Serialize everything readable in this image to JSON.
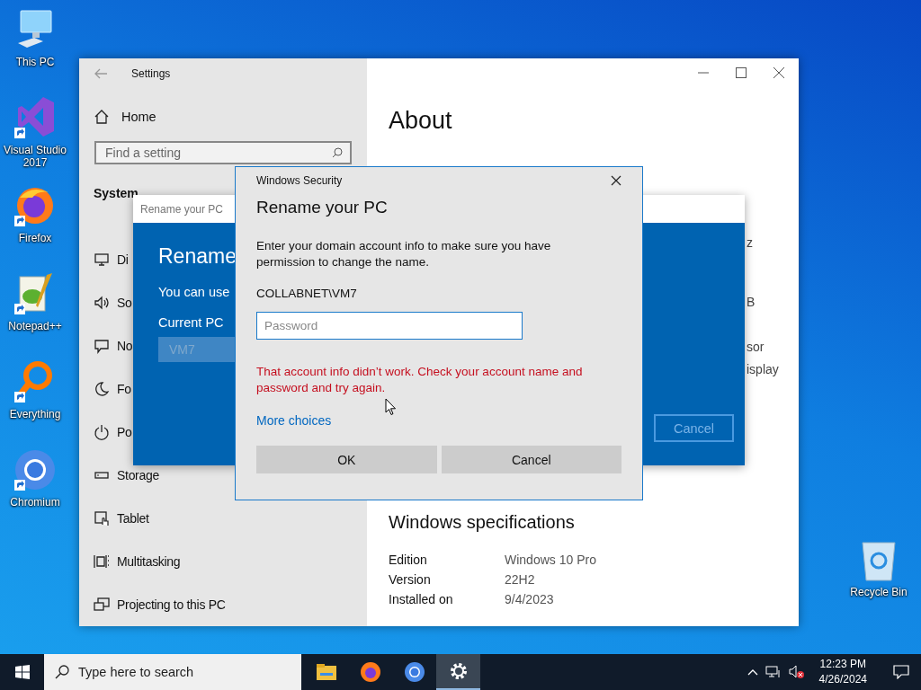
{
  "desktop_icons": [
    {
      "label": "This PC",
      "kind": "pc",
      "shortcut": false
    },
    {
      "label": "Visual Studio 2017",
      "kind": "vs",
      "shortcut": true
    },
    {
      "label": "Firefox",
      "kind": "firefox",
      "shortcut": true
    },
    {
      "label": "Notepad++",
      "kind": "notepad",
      "shortcut": true
    },
    {
      "label": "Everything",
      "kind": "everything",
      "shortcut": true
    },
    {
      "label": "Chromium",
      "kind": "chromium",
      "shortcut": true
    }
  ],
  "recycle_bin": {
    "label": "Recycle Bin"
  },
  "settings_window": {
    "title": "Settings",
    "home": "Home",
    "search": {
      "placeholder": "Find a setting"
    },
    "section": "System",
    "nav_items": [
      {
        "label": "Di",
        "kind": "display"
      },
      {
        "label": "So",
        "kind": "sound"
      },
      {
        "label": "No",
        "kind": "notifications"
      },
      {
        "label": "Fo",
        "kind": "focus"
      },
      {
        "label": "Po",
        "kind": "power"
      },
      {
        "label": "Storage",
        "kind": "storage"
      },
      {
        "label": "Tablet",
        "kind": "tablet"
      },
      {
        "label": "Multitasking",
        "kind": "multitasking"
      },
      {
        "label": "Projecting to this PC",
        "kind": "projecting"
      }
    ],
    "page_title": "About",
    "fragments": [
      "z",
      "B",
      "sor",
      "isplay"
    ],
    "specs_heading": "Windows specifications",
    "specs": [
      {
        "label": "Edition",
        "value": "Windows 10 Pro"
      },
      {
        "label": "Version",
        "value": "22H2"
      },
      {
        "label": "Installed on",
        "value": "9/4/2023"
      }
    ]
  },
  "rename_dialog": {
    "title": "Rename your PC",
    "heading": "Rename",
    "text": "You can use",
    "field_label": "Current PC",
    "field_value": "VM7",
    "cancel": "Cancel"
  },
  "security_dialog": {
    "title": "Windows Security",
    "heading": "Rename your PC",
    "message": "Enter your domain account info to make sure you have permission to change the name.",
    "account": "COLLABNET\\VM7",
    "password": {
      "placeholder": "Password"
    },
    "error": "That account info didn’t work. Check your account name and password and try again.",
    "link": "More choices",
    "buttons": [
      "OK",
      "Cancel"
    ]
  },
  "taskbar": {
    "search": {
      "placeholder": "Type here to search"
    },
    "apps": [
      {
        "kind": "explorer",
        "selected": false
      },
      {
        "kind": "firefox",
        "selected": false
      },
      {
        "kind": "chromium",
        "selected": false
      },
      {
        "kind": "settings",
        "selected": true
      }
    ],
    "time": "12:23 PM",
    "date": "4/26/2024"
  }
}
